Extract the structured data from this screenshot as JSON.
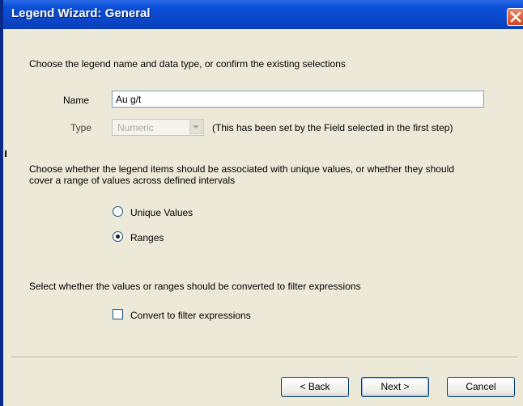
{
  "window": {
    "title": "Legend Wizard: General"
  },
  "general": {
    "instruction": "Choose the legend name and data type, or confirm the existing selections"
  },
  "name_field": {
    "label": "Name",
    "value": "Au g/t"
  },
  "type_field": {
    "label": "Type",
    "value": "Numeric",
    "note": "(This has been set by the Field selected in the first step)"
  },
  "association": {
    "instruction_line1": "Choose whether the legend items should be associated with unique values, or whether they should",
    "instruction_line2": "cover a range of values across defined intervals",
    "options": [
      {
        "label": "Unique Values",
        "checked": false
      },
      {
        "label": "Ranges",
        "checked": true
      }
    ]
  },
  "filter": {
    "instruction": "Select whether the values or ranges should be converted to filter expressions",
    "checkbox_label": "Convert to filter expressions",
    "checked": false
  },
  "buttons": {
    "back": "< Back",
    "next": "Next >",
    "cancel": "Cancel"
  }
}
